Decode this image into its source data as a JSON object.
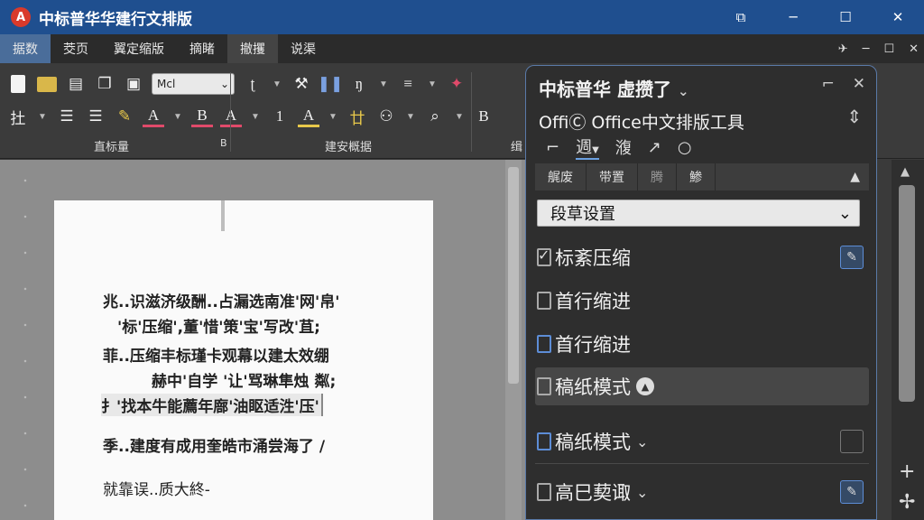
{
  "window": {
    "logo": "A",
    "title": "中标普华华建行文排版",
    "controls": [
      "⧉",
      "─",
      "☐",
      "✕"
    ]
  },
  "menubar": {
    "tabs": [
      "据数",
      "茭页",
      "翼定缩版",
      "摘睹",
      "撤攫",
      "说渠"
    ],
    "right_icons": [
      "✈",
      "─",
      "☐",
      "✕"
    ]
  },
  "ribbon": {
    "font_combo": "Mcl",
    "font_glyphs": [
      "A",
      "B",
      "A",
      "1",
      "A"
    ],
    "misc_glyphs": [
      "ŋ",
      "B"
    ],
    "group_labels": [
      "直标量",
      "B",
      "建安概据",
      "缉"
    ]
  },
  "document": {
    "lines": [
      "兆..识滋济级酬..占漏选南准'网'帛'",
      "'标'压缩',董'惜'策'宝'写改'苴;",
      "菲..压缩丰标瑾卡观幕以建太效绷",
      "赫中'自学 '让'骂琳隼烛 粼;",
      "扌'找本牛能薦年廍'油眍适泩'压'",
      "季..建度有成用奎皓市涌尝海了  /",
      "就靠误..质大終-"
    ]
  },
  "pane": {
    "title": "中标普华  虚攒了",
    "title_chevron": "⌄",
    "controls": [
      "⌐",
      "✕"
    ],
    "subtitle": "OffiⒸ Office中文排版工具",
    "subtitle_icon": "⇕",
    "tools": [
      "⌐",
      "週",
      "澓",
      "↗",
      "○"
    ],
    "tabs": [
      "艉废",
      "带置",
      "腾",
      "鯵"
    ],
    "tabs_chevron": "▲",
    "select": {
      "value": "段草设置",
      "arrow": "⌄"
    },
    "options": [
      {
        "label": "标紊压缩",
        "checked": true,
        "button": "✎"
      },
      {
        "label": "首行缩进",
        "checked": false
      },
      {
        "label": "首行缩进",
        "checked": false
      },
      {
        "label": "稿纸模式",
        "checked": false,
        "extra": "▲",
        "highlight": true
      },
      {
        "label": "稿纸模式",
        "checked": false,
        "extra": "⌄",
        "button": ""
      },
      {
        "label": "高巳葜诹",
        "checked": false,
        "extra": "⌄",
        "button": "✎"
      }
    ]
  },
  "scroll": {
    "up": "▲",
    "plus": "+",
    "move": "✢"
  }
}
